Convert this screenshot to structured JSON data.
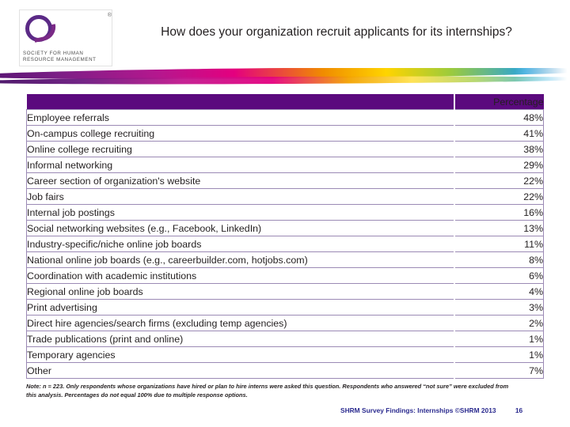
{
  "slide": {
    "title": "How does your organization recruit applicants for its internships?",
    "logo": {
      "name": "shrm-logo",
      "registered_mark": "®",
      "line1": "SOCIETY FOR HUMAN",
      "line2": "RESOURCE MANAGEMENT"
    }
  },
  "table": {
    "header": {
      "label_column": "",
      "value_column": "Percentage"
    },
    "rows": [
      {
        "label": "Employee referrals",
        "percentage": "48%"
      },
      {
        "label": "On-campus college recruiting",
        "percentage": "41%"
      },
      {
        "label": "Online college recruiting",
        "percentage": "38%"
      },
      {
        "label": "Informal networking",
        "percentage": "29%"
      },
      {
        "label": "Career section of organization's website",
        "percentage": "22%"
      },
      {
        "label": "Job fairs",
        "percentage": "22%"
      },
      {
        "label": "Internal job postings",
        "percentage": "16%"
      },
      {
        "label": "Social networking websites (e.g., Facebook, LinkedIn)",
        "percentage": "13%"
      },
      {
        "label": "Industry-specific/niche online job boards",
        "percentage": "11%"
      },
      {
        "label": "National online job boards (e.g., careerbuilder.com, hotjobs.com)",
        "percentage": "8%"
      },
      {
        "label": "Coordination with academic institutions",
        "percentage": "6%"
      },
      {
        "label": "Regional online job boards",
        "percentage": "4%"
      },
      {
        "label": "Print advertising",
        "percentage": "3%"
      },
      {
        "label": "Direct hire agencies/search firms (excluding temp agencies)",
        "percentage": "2%"
      },
      {
        "label": "Trade publications (print and online)",
        "percentage": "1%"
      },
      {
        "label": "Temporary agencies",
        "percentage": "1%"
      },
      {
        "label": "Other",
        "percentage": "7%"
      }
    ]
  },
  "note": "Note: n = 223. Only respondents whose organizations have hired or plan to hire interns were asked this question. Respondents who answered “not sure” were excluded from this analysis. Percentages do not equal 100% due to multiple response options.",
  "footer": {
    "source": "SHRM Survey Findings: Internships ©SHRM 2013",
    "page_number": "16"
  },
  "colors": {
    "header_purple": "#5B0A7E",
    "footer_blue": "#2B2B8F",
    "grid_line": "#9B8AB5"
  }
}
